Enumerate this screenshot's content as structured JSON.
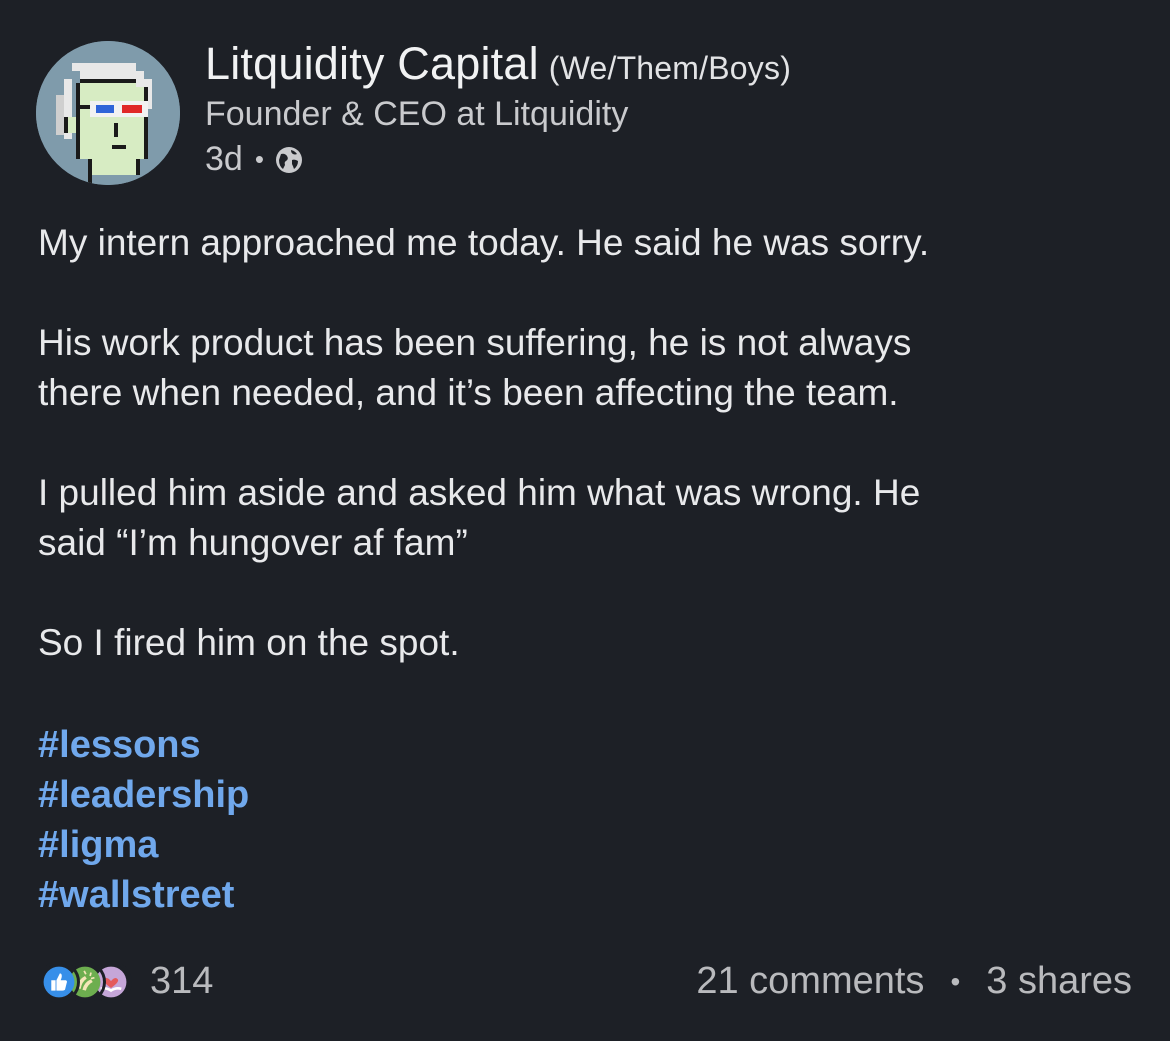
{
  "author": {
    "name": "Litquidity Capital",
    "pronouns": "(We/Them/Boys)",
    "headline": "Founder & CEO at Litquidity",
    "time": "3d",
    "separator": "•",
    "visibility_icon": "globe-icon",
    "avatar_icon": "pixel-avatar-icon"
  },
  "post": {
    "paragraphs": [
      "My intern approached me today. He said he was sorry.",
      "His work product has been suffering, he is not always\nthere when needed, and it’s been affecting the team.",
      "I pulled him aside and asked him what was wrong. He\nsaid “I’m hungover af fam”",
      "So I fired him on the spot."
    ],
    "hashtags": [
      "#lessons",
      "#leadership",
      "#ligma",
      "#wallstreet"
    ]
  },
  "social": {
    "reaction_icons": [
      "like-icon",
      "celebrate-icon",
      "care-icon"
    ],
    "reaction_count": "314",
    "comments": "21 comments",
    "separator": "•",
    "shares": "3 shares"
  },
  "colors": {
    "background": "#1d2026",
    "hashtag": "#70a8ec",
    "like": "#378fe9",
    "celebrate": "#6dae4f",
    "care": "#c5a6d8"
  }
}
